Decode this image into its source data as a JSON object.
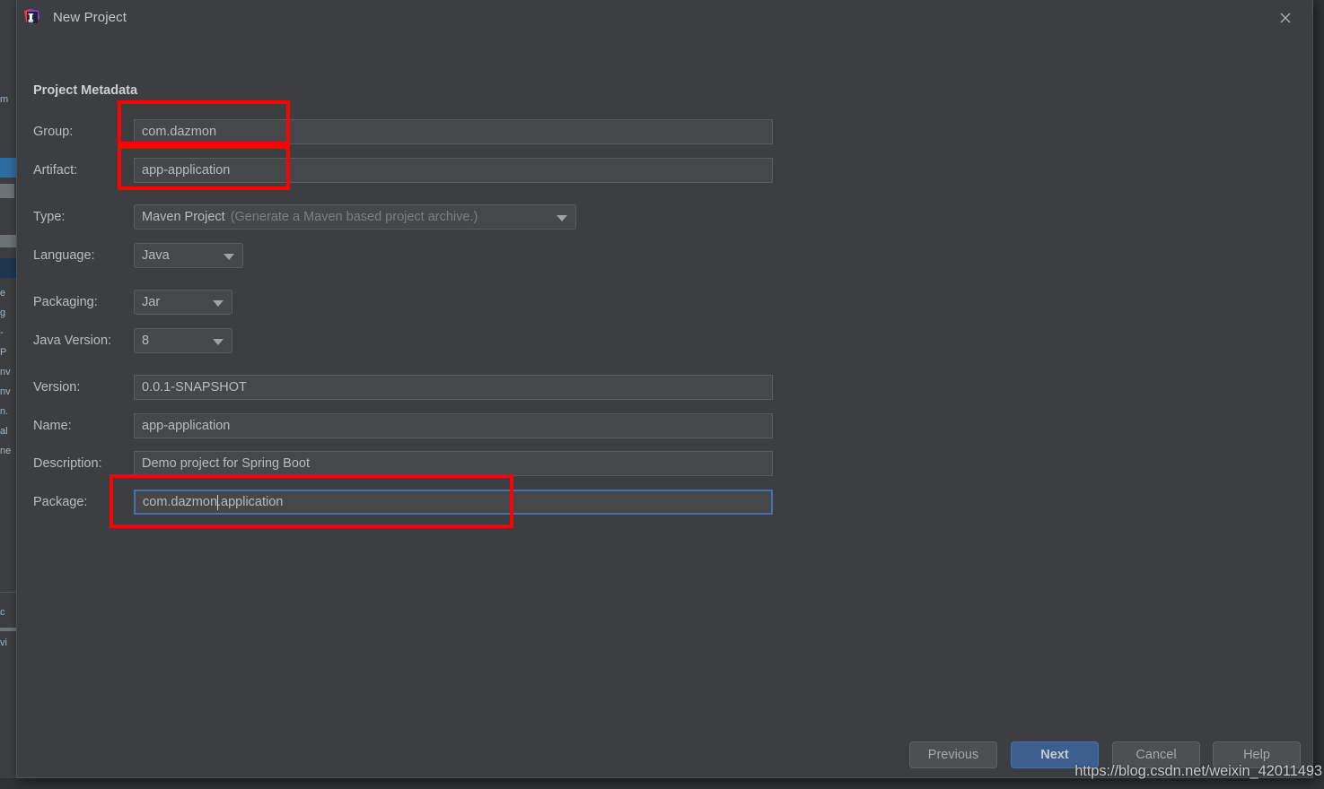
{
  "window": {
    "title": "New Project",
    "app_icon": "intellij-idea-icon",
    "close_icon": "close-icon"
  },
  "section": {
    "title": "Project Metadata"
  },
  "fields": {
    "group": {
      "label": "Group:",
      "value": "com.dazmon"
    },
    "artifact": {
      "label": "Artifact:",
      "value": "app-application"
    },
    "type": {
      "label": "Type:",
      "value": "Maven Project",
      "hint": "(Generate a Maven based project archive.)",
      "arrow_icon": "chevron-down-icon"
    },
    "language": {
      "label": "Language:",
      "value": "Java",
      "arrow_icon": "chevron-down-icon"
    },
    "packaging": {
      "label": "Packaging:",
      "value": "Jar",
      "arrow_icon": "chevron-down-icon"
    },
    "java_version": {
      "label": "Java Version:",
      "value": "8",
      "arrow_icon": "chevron-down-icon"
    },
    "version": {
      "label": "Version:",
      "value": "0.0.1-SNAPSHOT"
    },
    "name": {
      "label": "Name:",
      "value": "app-application"
    },
    "description": {
      "label": "Description:",
      "value": "Demo project for Spring Boot"
    },
    "package": {
      "label": "Package:",
      "value_before_caret": "com.dazmon",
      "value_after_caret": ".application"
    }
  },
  "buttons": {
    "previous": "Previous",
    "next": "Next",
    "cancel": "Cancel",
    "help": "Help"
  },
  "watermark": {
    "text": "https://blog.csdn.net/weixin_42011493"
  },
  "colors": {
    "dialog_bg": "#3c3f41",
    "field_bg": "#45484a",
    "accent_blue": "#4b6eaf",
    "primary_button": "#3c5f8f",
    "annotation_red": "#fb0303",
    "text": "#bbbdbf"
  },
  "backdrop": {
    "fragments": [
      "m",
      "",
      "e",
      "g",
      "-",
      "P",
      "nv",
      "nv",
      "n.",
      "al",
      "ne",
      "c",
      "vi"
    ]
  }
}
